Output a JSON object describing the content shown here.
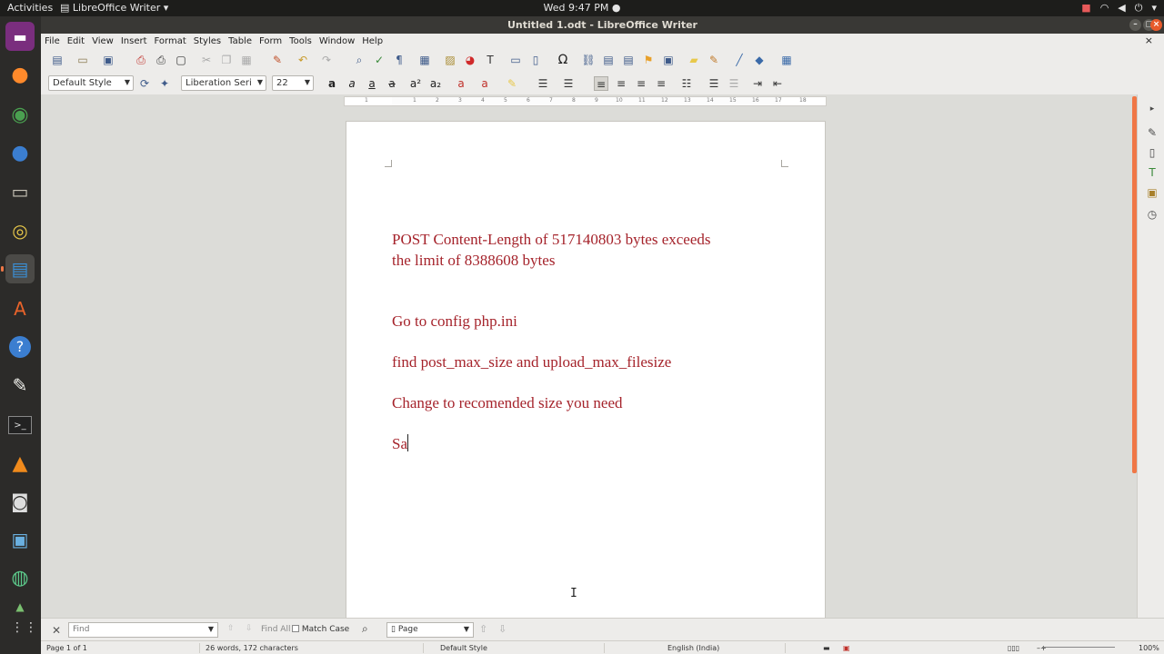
{
  "system": {
    "activities": "Activities",
    "app_menu": "LibreOffice Writer",
    "clock": "Wed  9:47 PM"
  },
  "window": {
    "title": "Untitled 1.odt - LibreOffice Writer"
  },
  "menu": [
    "File",
    "Edit",
    "View",
    "Insert",
    "Format",
    "Styles",
    "Table",
    "Form",
    "Tools",
    "Window",
    "Help"
  ],
  "formatting": {
    "paragraph_style": "Default Style",
    "font_name": "Liberation Seri",
    "font_size": "22"
  },
  "ruler": {
    "numbers": [
      "1",
      "1",
      "2",
      "3",
      "4",
      "5",
      "6",
      "7",
      "8",
      "9",
      "10",
      "11",
      "12",
      "13",
      "14",
      "15",
      "16",
      "17",
      "18"
    ]
  },
  "document": {
    "paragraphs": [
      "POST Content-Length of 517140803 bytes exceeds",
      "the limit of 8388608 bytes",
      "Go to config php.ini",
      "find  post_max_size and upload_max_filesize",
      "Change to recomended size you need",
      "Sa"
    ],
    "text_color": "#a5232b"
  },
  "findbar": {
    "placeholder": "Find",
    "find_all": "Find All",
    "match_case": "Match Case",
    "search_scope": "Page"
  },
  "status": {
    "page": "Page 1 of 1",
    "words": "26 words, 172 characters",
    "style": "Default Style",
    "language": "English (India)",
    "zoom": "100%"
  },
  "colors": {
    "accent": "#f07746",
    "topbar": "#1d1d1b",
    "dock": "#2c2b29"
  }
}
